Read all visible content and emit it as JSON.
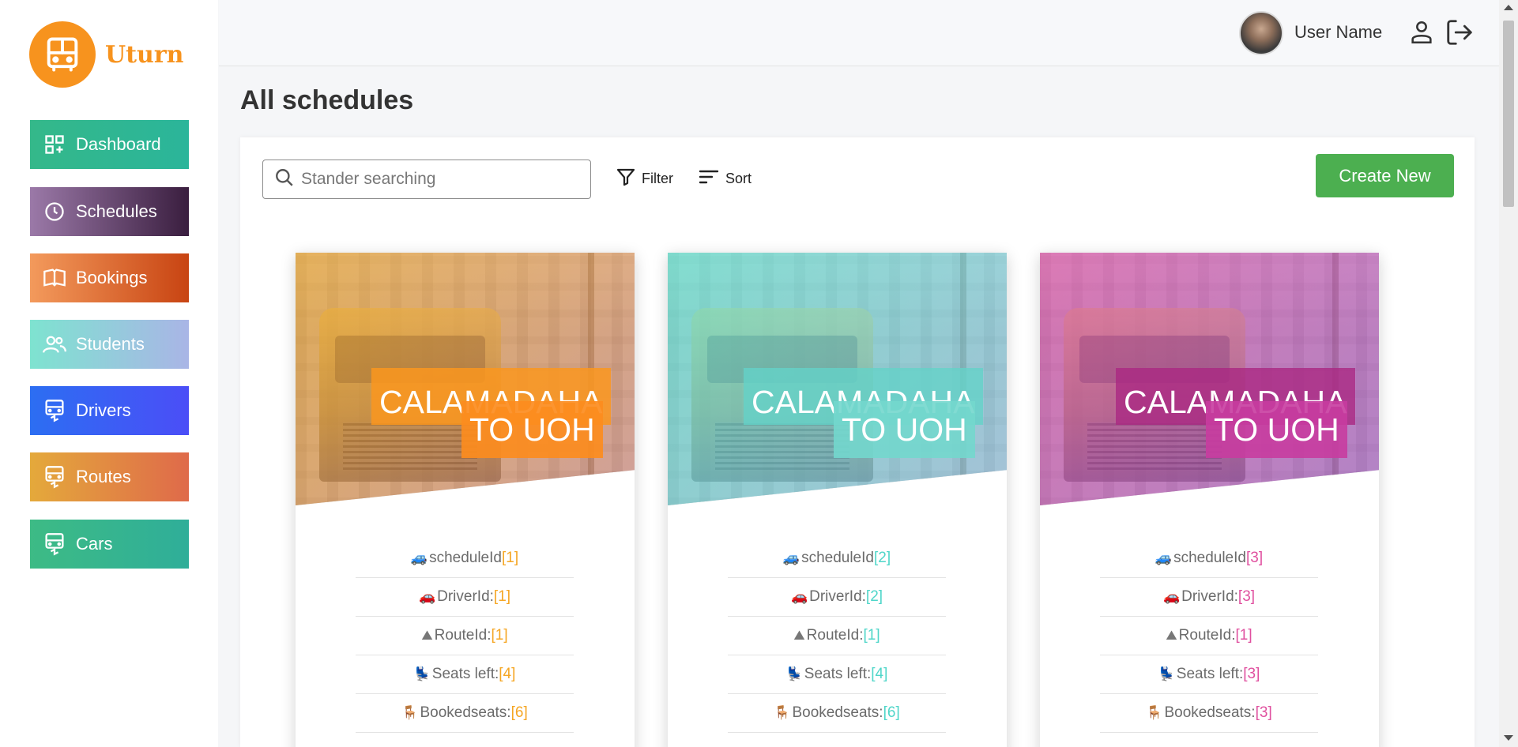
{
  "app": {
    "name": "Uturn",
    "brand_color": "#f7931e"
  },
  "sidebar": {
    "items": [
      {
        "label": "Dashboard",
        "icon": "dashboard-icon"
      },
      {
        "label": "Schedules",
        "icon": "clock-icon"
      },
      {
        "label": "Bookings",
        "icon": "book-icon"
      },
      {
        "label": "Students",
        "icon": "users-icon"
      },
      {
        "label": "Drivers",
        "icon": "bus-icon"
      },
      {
        "label": "Routes",
        "icon": "bus-icon"
      },
      {
        "label": "Cars",
        "icon": "bus-icon"
      }
    ]
  },
  "header": {
    "username": "User Name"
  },
  "page": {
    "title": "All schedules"
  },
  "toolbar": {
    "search_placeholder": "Stander searching",
    "filter_label": "Filter",
    "sort_label": "Sort",
    "create_label": "Create New"
  },
  "cards": [
    {
      "title_line1": "CALAMADAHA",
      "title_line2": "TO UOH",
      "accent": "#f5a623",
      "rows": [
        {
          "label": "scheduleId ",
          "value": "[1]",
          "icon": "car-icon"
        },
        {
          "label": "DriverId:",
          "value": "[1]",
          "icon": "red-car-icon"
        },
        {
          "label": "RouteId:",
          "value": "[1]",
          "icon": "route-icon"
        },
        {
          "label": "Seats left:",
          "value": "[4]",
          "icon": "seat-icon"
        },
        {
          "label": "Bookedseats:",
          "value": "[6]",
          "icon": "chair-icon"
        }
      ]
    },
    {
      "title_line1": "CALAMADAHA",
      "title_line2": "TO UOH",
      "accent": "#4fd6c9",
      "rows": [
        {
          "label": "scheduleId ",
          "value": "[2]",
          "icon": "car-icon"
        },
        {
          "label": "DriverId:",
          "value": "[2]",
          "icon": "red-car-icon"
        },
        {
          "label": "RouteId:",
          "value": "[1]",
          "icon": "route-icon"
        },
        {
          "label": "Seats left:",
          "value": "[4]",
          "icon": "seat-icon"
        },
        {
          "label": "Bookedseats:",
          "value": "[6]",
          "icon": "chair-icon"
        }
      ]
    },
    {
      "title_line1": "CALAMADAHA",
      "title_line2": "TO UOH",
      "accent": "#e0509f",
      "rows": [
        {
          "label": "scheduleId ",
          "value": "[3]",
          "icon": "car-icon"
        },
        {
          "label": "DriverId:",
          "value": "[3]",
          "icon": "red-car-icon"
        },
        {
          "label": "RouteId:",
          "value": "[1]",
          "icon": "route-icon"
        },
        {
          "label": "Seats left:",
          "value": "[3]",
          "icon": "seat-icon"
        },
        {
          "label": "Bookedseats:",
          "value": "[3]",
          "icon": "chair-icon"
        }
      ]
    }
  ]
}
